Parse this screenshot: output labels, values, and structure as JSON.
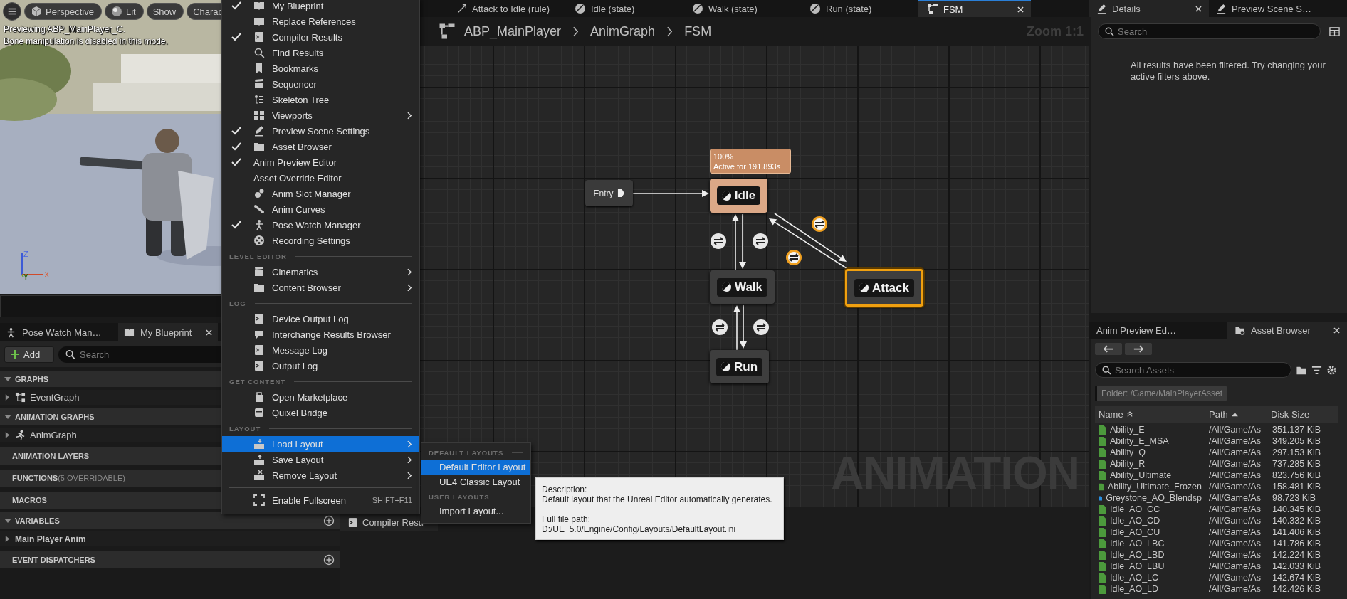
{
  "viewport": {
    "toolbar": [
      {
        "label": "Perspective",
        "kind": "cube"
      },
      {
        "label": "Lit",
        "kind": "sphere"
      },
      {
        "label": "Show",
        "kind": "plain"
      },
      {
        "label": "Charac",
        "kind": "plain"
      }
    ],
    "messages": [
      "Previewing ABP_MainPlayer_C.",
      "Bone manipulation is disabled in this mode."
    ],
    "axes": [
      "Z",
      "X",
      "Y"
    ]
  },
  "left_tabs": [
    {
      "label": "Pose Watch Man…",
      "selected": false,
      "closable": false
    },
    {
      "label": "My Blueprint",
      "selected": true,
      "closable": true
    }
  ],
  "my_blueprint": {
    "add_button": "Add",
    "search_placeholder": "Search",
    "sections": [
      {
        "kind": "category",
        "title": "GRAPHS",
        "expanded": true,
        "addable": false,
        "items": [
          {
            "label": "EventGraph",
            "expanded": false
          }
        ]
      },
      {
        "kind": "category",
        "title": "ANIMATION GRAPHS",
        "expanded": true,
        "addable": false,
        "items": [
          {
            "label": "AnimGraph",
            "expanded": false
          }
        ]
      },
      {
        "kind": "plain",
        "title": "ANIMATION LAYERS",
        "addable": false
      },
      {
        "kind": "plain",
        "title": "FUNCTIONS",
        "note": "(5 OVERRIDABLE)",
        "addable": false
      },
      {
        "kind": "plain",
        "title": "MACROS",
        "addable": false
      },
      {
        "kind": "category",
        "title": "VARIABLES",
        "expanded": true,
        "addable": true,
        "items": [
          {
            "label": "Main Player Anim",
            "expanded": false
          }
        ]
      },
      {
        "kind": "plain",
        "title": "EVENT DISPATCHERS",
        "addable": true
      }
    ]
  },
  "graph_tabs": [
    {
      "label": "Attack to Idle (rule)",
      "kind": "rule",
      "selected": false,
      "closable": false
    },
    {
      "label": "Idle (state)",
      "kind": "state",
      "selected": false,
      "closable": false
    },
    {
      "label": "Walk (state)",
      "kind": "state",
      "selected": false,
      "closable": false
    },
    {
      "label": "Run (state)",
      "kind": "state",
      "selected": false,
      "closable": false
    },
    {
      "label": "FSM",
      "kind": "machine",
      "selected": true,
      "closable": true
    }
  ],
  "breadcrumb": [
    "ABP_MainPlayer",
    "AnimGraph",
    "FSM"
  ],
  "zoom": "Zoom 1:1",
  "state_machine": {
    "entry": "Entry",
    "active_tooltip": [
      "100%",
      "Active for 191.893s"
    ],
    "states": [
      {
        "label": "Idle",
        "active": true,
        "selected": false
      },
      {
        "label": "Walk",
        "active": false,
        "selected": false
      },
      {
        "label": "Run",
        "active": false,
        "selected": false
      },
      {
        "label": "Attack",
        "active": false,
        "selected": true
      }
    ],
    "transitions": [
      {
        "highlighted": false
      },
      {
        "highlighted": false
      },
      {
        "highlighted": true
      },
      {
        "highlighted": true
      },
      {
        "highlighted": false
      },
      {
        "highlighted": false
      }
    ]
  },
  "watermark": "ANIMATION",
  "bottom_tabs": [
    {
      "label": "Compiler Resu"
    }
  ],
  "menu": {
    "sections": [
      {
        "items": [
          {
            "label": "My Blueprint",
            "checked": true,
            "has_submenu": false,
            "selected": false
          },
          {
            "label": "Replace References",
            "checked": false,
            "has_submenu": false,
            "selected": false
          },
          {
            "label": "Compiler Results",
            "checked": true,
            "has_submenu": false,
            "selected": false
          },
          {
            "label": "Find Results",
            "checked": false,
            "has_submenu": false,
            "selected": false
          },
          {
            "label": "Bookmarks",
            "checked": false,
            "has_submenu": false,
            "selected": false
          },
          {
            "label": "Sequencer",
            "checked": false,
            "has_submenu": false,
            "selected": false
          },
          {
            "label": "Skeleton Tree",
            "checked": false,
            "has_submenu": false,
            "selected": false
          },
          {
            "label": "Viewports",
            "checked": false,
            "has_submenu": true,
            "selected": false
          },
          {
            "label": "Preview Scene Settings",
            "checked": true,
            "has_submenu": false,
            "selected": false
          },
          {
            "label": "Asset Browser",
            "checked": true,
            "has_submenu": false,
            "selected": false
          },
          {
            "label": "Anim Preview Editor",
            "checked": true,
            "has_submenu": false,
            "selected": false
          },
          {
            "label": "Asset Override Editor",
            "checked": false,
            "has_submenu": false,
            "selected": false
          },
          {
            "label": "Anim Slot Manager",
            "checked": false,
            "has_submenu": false,
            "selected": false
          },
          {
            "label": "Anim Curves",
            "checked": false,
            "has_submenu": false,
            "selected": false
          },
          {
            "label": "Pose Watch Manager",
            "checked": true,
            "has_submenu": false,
            "selected": false
          },
          {
            "label": "Recording Settings",
            "checked": false,
            "has_submenu": false,
            "selected": false
          }
        ]
      },
      {
        "header": "LEVEL EDITOR",
        "items": [
          {
            "label": "Cinematics",
            "checked": false,
            "has_submenu": true,
            "selected": false
          },
          {
            "label": "Content Browser",
            "checked": false,
            "has_submenu": true,
            "selected": false
          }
        ]
      },
      {
        "header": "LOG",
        "items": [
          {
            "label": "Device Output Log",
            "checked": false,
            "has_submenu": false,
            "selected": false
          },
          {
            "label": "Interchange Results Browser",
            "checked": false,
            "has_submenu": false,
            "selected": false
          },
          {
            "label": "Message Log",
            "checked": false,
            "has_submenu": false,
            "selected": false
          },
          {
            "label": "Output Log",
            "checked": false,
            "has_submenu": false,
            "selected": false
          }
        ]
      },
      {
        "header": "GET CONTENT",
        "items": [
          {
            "label": "Open Marketplace",
            "checked": false,
            "has_submenu": false,
            "selected": false
          },
          {
            "label": "Quixel Bridge",
            "checked": false,
            "has_submenu": false,
            "selected": false
          }
        ]
      },
      {
        "header": "LAYOUT",
        "items": [
          {
            "label": "Load Layout",
            "checked": false,
            "has_submenu": true,
            "selected": true
          },
          {
            "label": "Save Layout",
            "checked": false,
            "has_submenu": true,
            "selected": false
          },
          {
            "label": "Remove Layout",
            "checked": false,
            "has_submenu": true,
            "selected": false
          }
        ]
      },
      {
        "items": [
          {
            "label": "Enable Fullscreen",
            "checked": false,
            "has_submenu": false,
            "selected": false,
            "shortcut": "SHIFT+F11"
          }
        ]
      }
    ]
  },
  "submenu": {
    "sections": [
      {
        "header": "DEFAULT LAYOUTS",
        "items": [
          {
            "label": "Default Editor Layout",
            "selected": true
          },
          {
            "label": "UE4 Classic Layout",
            "selected": false
          }
        ]
      },
      {
        "header": "USER LAYOUTS",
        "items": [
          {
            "label": "Import Layout...",
            "selected": false
          }
        ]
      }
    ]
  },
  "tooltip": {
    "lines": [
      "Description:",
      "Default layout that the Unreal Editor automatically generates.",
      "Full file path:",
      "D:/UE_5.0/Engine/Config/Layouts/DefaultLayout.ini"
    ]
  },
  "details": {
    "tabs": [
      {
        "label": "Details",
        "selected": true,
        "closable": true
      },
      {
        "label": "Preview Scene S…",
        "selected": false,
        "closable": false
      }
    ],
    "search_placeholder": "Search",
    "message": "All results have been filtered. Try changing your active filters above."
  },
  "asset_browser": {
    "tabs": [
      {
        "label": "Anim Preview Ed…",
        "selected": false,
        "closable": false,
        "kind": "plain"
      },
      {
        "label": "Asset Browser",
        "selected": true,
        "closable": true,
        "kind": "folder"
      }
    ],
    "search_placeholder": "Search Assets",
    "folder": "Folder: /Game/MainPlayerAsset",
    "columns": [
      {
        "label": "Name",
        "kind": "secondary"
      },
      {
        "label": "Path",
        "kind": "ascending"
      },
      {
        "label": "Disk Size",
        "kind": "plain"
      }
    ],
    "rows": [
      {
        "name": "Ability_E",
        "path": "/All/Game/As",
        "size": "351.137 KiB",
        "color": "#4c9a3c"
      },
      {
        "name": "Ability_E_MSA",
        "path": "/All/Game/As",
        "size": "349.205 KiB",
        "color": "#4c9a3c"
      },
      {
        "name": "Ability_Q",
        "path": "/All/Game/As",
        "size": "297.153 KiB",
        "color": "#4c9a3c"
      },
      {
        "name": "Ability_R",
        "path": "/All/Game/As",
        "size": "737.285 KiB",
        "color": "#4c9a3c"
      },
      {
        "name": "Ability_Ultimate",
        "path": "/All/Game/As",
        "size": "823.756 KiB",
        "color": "#4c9a3c"
      },
      {
        "name": "Ability_Ultimate_Frozen",
        "path": "/All/Game/As",
        "size": "158.481 KiB",
        "color": "#4c9a3c"
      },
      {
        "name": "Greystone_AO_Blendsp",
        "path": "/All/Game/As",
        "size": "98.723 KiB",
        "color": "#2a8fe0"
      },
      {
        "name": "Idle_AO_CC",
        "path": "/All/Game/As",
        "size": "140.345 KiB",
        "color": "#4c9a3c"
      },
      {
        "name": "Idle_AO_CD",
        "path": "/All/Game/As",
        "size": "140.332 KiB",
        "color": "#4c9a3c"
      },
      {
        "name": "Idle_AO_CU",
        "path": "/All/Game/As",
        "size": "141.406 KiB",
        "color": "#4c9a3c"
      },
      {
        "name": "Idle_AO_LBC",
        "path": "/All/Game/As",
        "size": "141.786 KiB",
        "color": "#4c9a3c"
      },
      {
        "name": "Idle_AO_LBD",
        "path": "/All/Game/As",
        "size": "142.224 KiB",
        "color": "#4c9a3c"
      },
      {
        "name": "Idle_AO_LBU",
        "path": "/All/Game/As",
        "size": "142.033 KiB",
        "color": "#4c9a3c"
      },
      {
        "name": "Idle_AO_LC",
        "path": "/All/Game/As",
        "size": "142.674 KiB",
        "color": "#4c9a3c"
      },
      {
        "name": "Idle_AO_LD",
        "path": "/All/Game/As",
        "size": "142.426 KiB",
        "color": "#4c9a3c"
      }
    ]
  }
}
